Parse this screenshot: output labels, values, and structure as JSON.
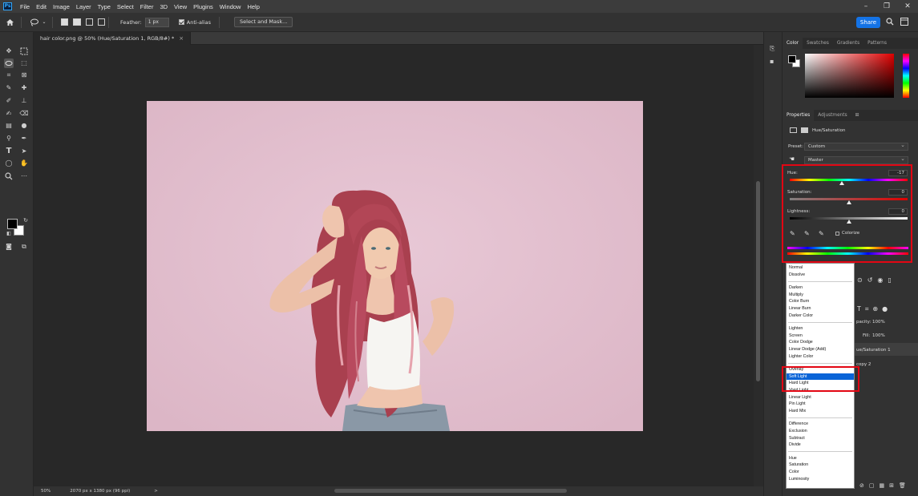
{
  "app": {
    "logo": "Ps"
  },
  "menu": [
    "File",
    "Edit",
    "Image",
    "Layer",
    "Type",
    "Select",
    "Filter",
    "3D",
    "View",
    "Plugins",
    "Window",
    "Help"
  ],
  "window_controls": [
    "–",
    "❐",
    "✕"
  ],
  "options_bar": {
    "feather_label": "Feather:",
    "feather_value": "1 px",
    "antialias_label": "Anti-alias",
    "select_mask_label": "Select and Mask...",
    "share_label": "Share"
  },
  "document": {
    "tab_title": "hair color.png @ 50% (Hue/Saturation 1, RGB/8#) *",
    "tab_close": "×",
    "zoom": "50%",
    "doc_info": "2070 px x 1380 px (96 ppi)",
    "status_arrow": ">"
  },
  "color_panel": {
    "tabs": [
      "Color",
      "Swatches",
      "Gradients",
      "Patterns"
    ],
    "active_tab": "Color"
  },
  "properties": {
    "tabs": [
      "Properties",
      "Adjustments"
    ],
    "active_tab": "Properties",
    "title": "Hue/Saturation",
    "preset_label": "Preset:",
    "preset_value": "Custom",
    "channel_value": "Master",
    "hue_label": "Hue:",
    "hue_value": "-17",
    "hue_fraction": 0.44,
    "saturation_label": "Saturation:",
    "saturation_value": "0",
    "saturation_fraction": 0.5,
    "lightness_label": "Lightness:",
    "lightness_value": "0",
    "lightness_fraction": 0.5,
    "colorize_label": "Colorize"
  },
  "blend_modes": {
    "groups": [
      [
        "Normal",
        "Dissolve"
      ],
      [
        "Darken",
        "Multiply",
        "Color Burn",
        "Linear Burn",
        "Darker Color"
      ],
      [
        "Lighten",
        "Screen",
        "Color Dodge",
        "Linear Dodge (Add)",
        "Lighter Color"
      ],
      [
        "Overlay",
        "Soft Light",
        "Hard Light",
        "Vivid Light",
        "Linear Light",
        "Pin Light",
        "Hard Mix"
      ],
      [
        "Difference",
        "Exclusion",
        "Subtract",
        "Divide"
      ],
      [
        "Hue",
        "Saturation",
        "Color",
        "Luminosity"
      ]
    ],
    "selected": "Soft Light"
  },
  "layers_fragment": {
    "opacity_label": "pacity:",
    "opacity_value": "100%",
    "fill_label": "Fill:",
    "fill_value": "100%",
    "layer1": "ue/Saturation 1",
    "layer2": "copy 2"
  },
  "colors": {
    "highlight_red": "#e30613",
    "accent_blue": "#1473e6",
    "selection_blue": "#0a64d7",
    "canvas_pink": "#e3c1cf"
  }
}
